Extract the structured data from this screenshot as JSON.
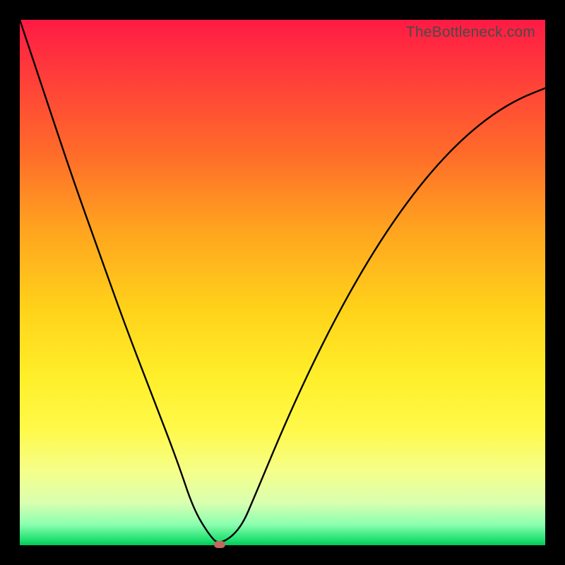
{
  "watermark": "TheBottleneck.com",
  "chart_data": {
    "type": "line",
    "title": "",
    "xlabel": "",
    "ylabel": "",
    "xlim": [
      0,
      100
    ],
    "ylim": [
      0,
      100
    ],
    "series": [
      {
        "name": "bottleneck-curve",
        "x": [
          0,
          5,
          10,
          15,
          20,
          25,
          30,
          33,
          36,
          38,
          42,
          45,
          50,
          55,
          60,
          65,
          70,
          75,
          80,
          85,
          90,
          95,
          100
        ],
        "y": [
          100,
          85,
          70,
          56,
          42,
          29,
          16,
          7,
          2,
          0,
          3,
          10,
          22,
          33,
          43,
          52,
          60,
          67,
          73,
          78,
          82,
          85,
          87
        ]
      }
    ],
    "annotations": [
      {
        "name": "min-marker",
        "x": 38,
        "y": 0,
        "color": "#c1675e"
      }
    ],
    "background_gradient": {
      "top": "#ff1a44",
      "mid": "#ffd21a",
      "bottom": "#00c85a"
    }
  }
}
